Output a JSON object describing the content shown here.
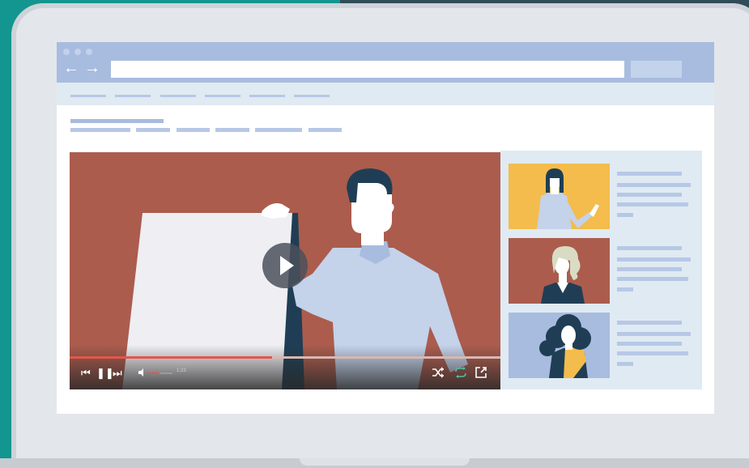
{
  "colors": {
    "background_teal": "#12968f",
    "background_dark": "#2f4c57",
    "laptop_body": "#e3e7eb",
    "browser_chrome": "#a8bcdf",
    "placeholder_line": "#b7c8e6",
    "video_background": "#ab5c4d",
    "progress_accent": "#e3564a",
    "loop_active": "#4fc1a3",
    "thumb_yellow": "#f4bc4c",
    "thumb_red": "#ab5c4d",
    "thumb_blue": "#a8bcdf"
  },
  "browser": {
    "window_controls": [
      "close-dot",
      "minimize-dot",
      "maximize-dot"
    ],
    "nav": {
      "back_icon": "←",
      "forward_icon": "→"
    },
    "url_value": "",
    "tab_count": 6
  },
  "video_player": {
    "progress": 0.47,
    "volume": 0.45,
    "time": "1:23",
    "icons": {
      "prev": "skip-back-icon",
      "pause": "pause-icon",
      "next": "skip-forward-icon",
      "volume": "volume-icon",
      "shuffle": "shuffle-icon",
      "loop": "repeat-icon",
      "share": "external-link-icon",
      "play": "play-icon"
    }
  },
  "playlist": [
    {
      "thumb_color": "#f4bc4c",
      "subject": "woman-waving"
    },
    {
      "thumb_color": "#ab5c4d",
      "subject": "woman-blonde"
    },
    {
      "thumb_color": "#a8bcdf",
      "subject": "woman-curly-hair"
    }
  ]
}
